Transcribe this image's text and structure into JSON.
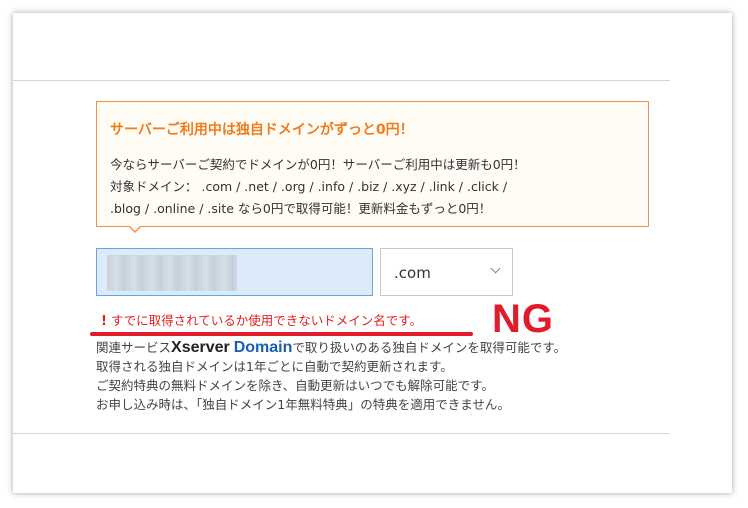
{
  "promo": {
    "title": "サーバーご利用中は独自ドメインがずっと0円！",
    "lines": [
      "今ならサーバーご契約でドメインが0円！サーバーご利用中は更新も0円！",
      "対象ドメイン： .com / .net / .org / .info / .biz / .xyz / .link / .click /",
      ".blog / .online / .site なら0円で取得可能！更新料金もずっと0円！"
    ]
  },
  "domain_input": {
    "value": ""
  },
  "tld_select": {
    "selected": ".com"
  },
  "error": {
    "icon": "!",
    "icon_name": "exclamation-icon",
    "message": "すでに取得されているか使用できないドメイン名です。"
  },
  "annotation": {
    "text": "NG"
  },
  "notes": {
    "line1_prefix": "関連サービス",
    "brand_x": "Xserver",
    "brand_domain": "Domain",
    "line1_suffix": "で取り扱いのある独自ドメインを取得可能です。",
    "line2": "取得される独自ドメインは1年ごとに自動で契約更新されます。",
    "line3": "ご契約特典の無料ドメインを除き、自動更新はいつでも解除可能です。",
    "line4": "お申し込み時は、「独自ドメイン1年無料特典」の特典を適用できません。"
  },
  "colors": {
    "accent_orange": "#ee7d1c",
    "error_red": "#e02020",
    "brand_blue": "#1a5fb4",
    "input_bg": "#dcebfb"
  }
}
